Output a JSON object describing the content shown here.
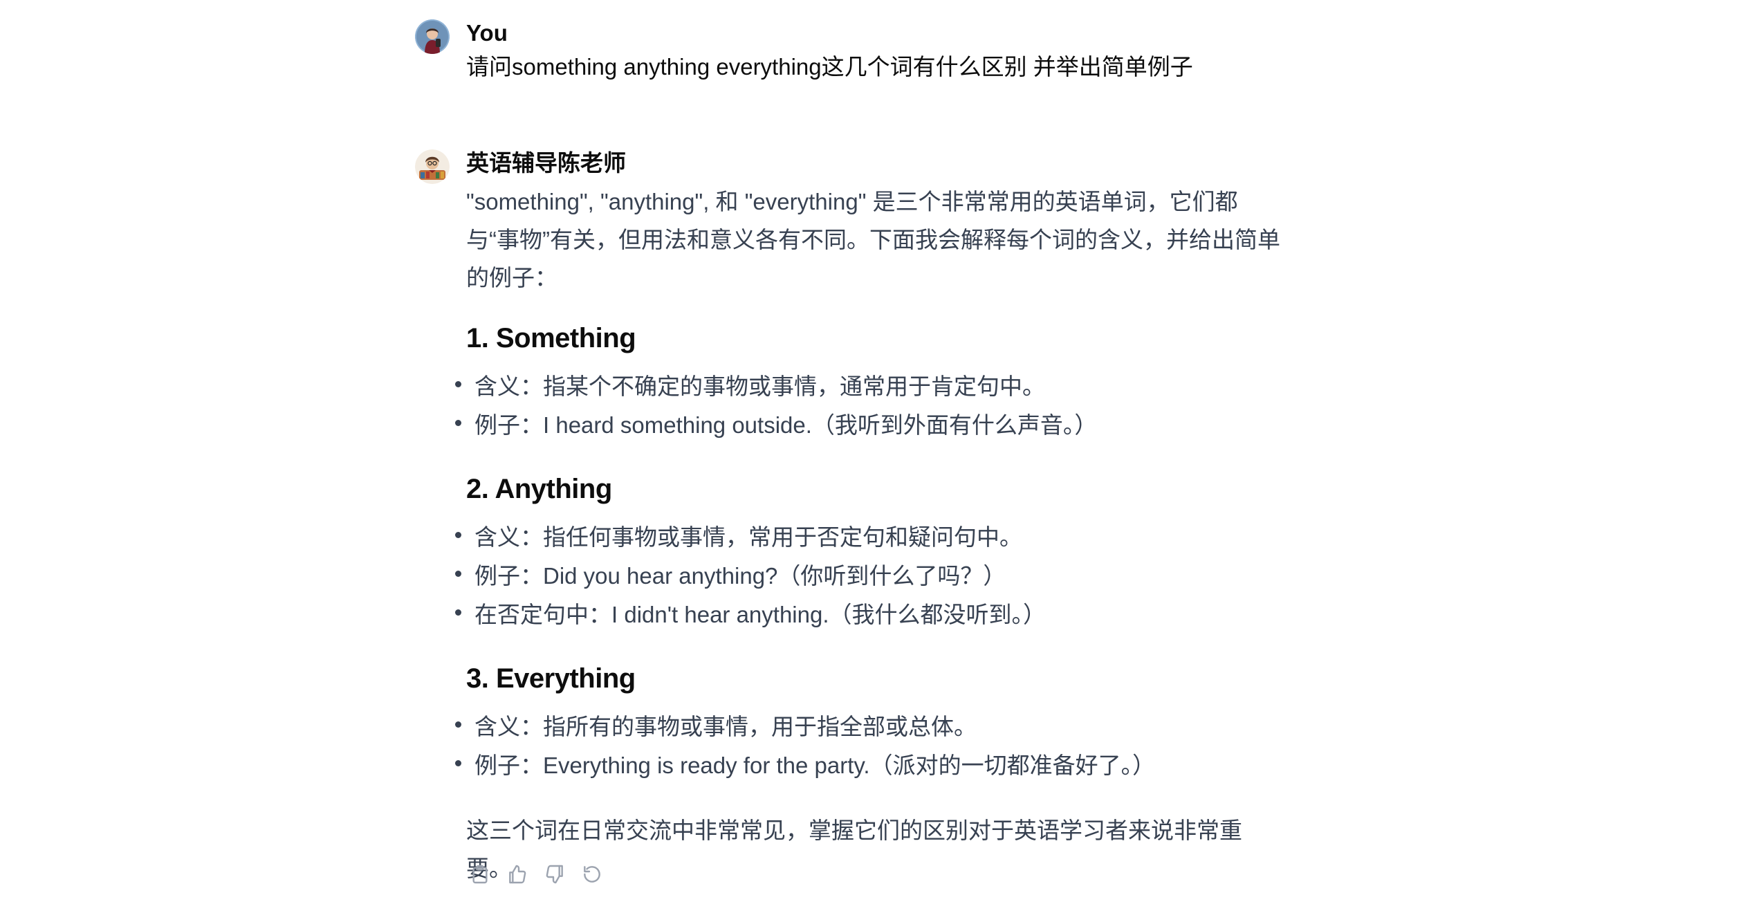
{
  "conversation": {
    "user_message": {
      "author": "You",
      "text": "请问something anything everything这几个词有什么区别 并举出简单例子"
    },
    "assistant_message": {
      "author": "英语辅导陈老师",
      "intro": "\"something\", \"anything\", 和 \"everything\" 是三个非常常用的英语单词，它们都与“事物”有关，但用法和意义各有不同。下面我会解释每个词的含义，并给出简单的例子：",
      "sections": [
        {
          "heading": "1. Something",
          "bullets": [
            "含义：指某个不确定的事物或事情，通常用于肯定句中。",
            "例子：I heard something outside.（我听到外面有什么声音。）"
          ]
        },
        {
          "heading": "2. Anything",
          "bullets": [
            "含义：指任何事物或事情，常用于否定句和疑问句中。",
            "例子：Did you hear anything?（你听到什么了吗？）",
            "在否定句中：I didn't hear anything.（我什么都没听到。）"
          ]
        },
        {
          "heading": "3. Everything",
          "bullets": [
            "含义：指所有的事物或事情，用于指全部或总体。",
            "例子：Everything is ready for the party.（派对的一切都准备好了。）"
          ]
        }
      ],
      "conclusion": "这三个词在日常交流中非常常见，掌握它们的区别对于英语学习者来说非常重要。"
    },
    "actions": [
      {
        "icon": "clipboard-icon"
      },
      {
        "icon": "thumbs-up-icon"
      },
      {
        "icon": "thumbs-down-icon"
      },
      {
        "icon": "regenerate-icon"
      }
    ]
  }
}
